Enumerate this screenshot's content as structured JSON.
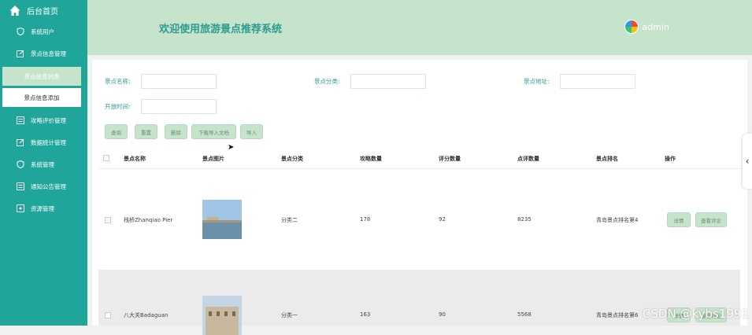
{
  "sidebar": {
    "home": "后台首页",
    "items": [
      {
        "label": "系统用户",
        "icon": "shield-icon"
      },
      {
        "label": "景点信息管理",
        "icon": "edit-icon"
      }
    ],
    "sub_items": [
      {
        "label": "景点信息列表",
        "active": true
      },
      {
        "label": "景点信息添加",
        "active": false
      }
    ],
    "items2": [
      {
        "label": "攻略评价管理",
        "icon": "table-icon"
      },
      {
        "label": "数据统计管理",
        "icon": "edit-icon"
      },
      {
        "label": "系统管理",
        "icon": "shield-icon"
      },
      {
        "label": "通知公告管理",
        "icon": "table-icon"
      },
      {
        "label": "资源管理",
        "icon": "gear-icon"
      }
    ]
  },
  "header": {
    "title": "欢迎使用旅游景点推荐系统",
    "user": "admin"
  },
  "filters": {
    "name_label": "景点名称:",
    "category_label": "景点分类:",
    "address_label": "景点地址:",
    "open_time_label": "开放时间:"
  },
  "buttons": {
    "search": "查询",
    "reset": "重置",
    "delete": "删除",
    "download": "下载导入文档",
    "import": "导入"
  },
  "table": {
    "headers": [
      "景点名称",
      "景点图片",
      "景点分类",
      "攻略数量",
      "评分数量",
      "点评数量",
      "景点排名",
      "操作"
    ],
    "rows": [
      {
        "name": "栈桥Zhanqiao Pier",
        "category": "分类二",
        "guides": "178",
        "ratings": "92",
        "reviews": "8235",
        "rank": "青岛景点排名第4",
        "op1": "详情",
        "op2": "查看评论"
      },
      {
        "name": "八大关Badaguan",
        "category": "分类一",
        "guides": "163",
        "ratings": "90",
        "reviews": "5568",
        "rank": "青岛景点排名第6",
        "op1": "详情",
        "op2": "查看评论"
      }
    ]
  },
  "watermark": "CSDN @kybs1991",
  "colors": {
    "sidebar": "#1fa59a",
    "header": "#c6e3cc",
    "accent_text": "#2c9c8e"
  }
}
